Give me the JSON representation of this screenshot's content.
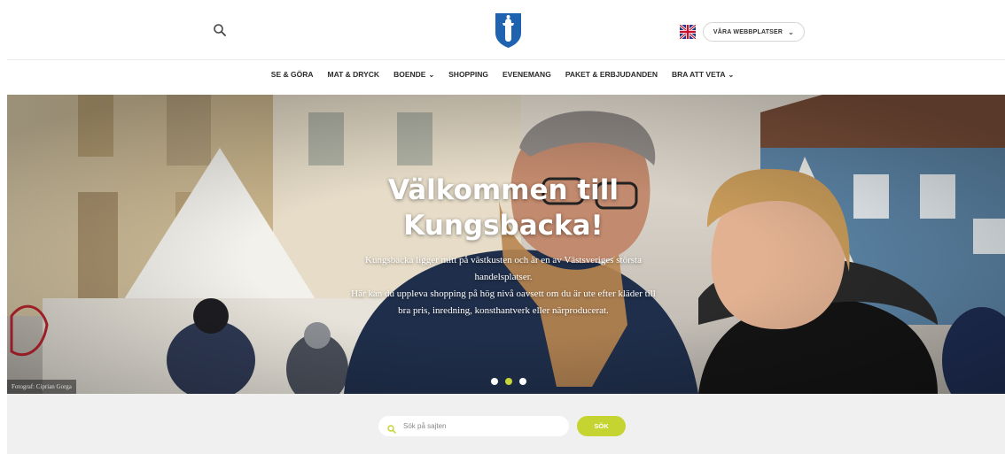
{
  "header": {
    "sites_button_label": "VÅRA WEBBPLATSER",
    "language_flag": "uk-flag-icon",
    "search_icon": "search-icon",
    "logo": "kungsbacka-crest-logo"
  },
  "nav": {
    "items": [
      {
        "label": "SE & GÖRA",
        "has_dropdown": false
      },
      {
        "label": "MAT & DRYCK",
        "has_dropdown": false
      },
      {
        "label": "BOENDE",
        "has_dropdown": true
      },
      {
        "label": "SHOPPING",
        "has_dropdown": false
      },
      {
        "label": "EVENEMANG",
        "has_dropdown": false
      },
      {
        "label": "PAKET & ERBJUDANDEN",
        "has_dropdown": false
      },
      {
        "label": "BRA ATT VETA",
        "has_dropdown": true
      }
    ]
  },
  "hero": {
    "title_line1": "Välkommen till",
    "title_line2": "Kungsbacka!",
    "text_line1": "Kungsbacka ligger mitt på västkusten och är en av Västsveriges största",
    "text_line2": "handelsplatser.",
    "text_line3": "Här kan du uppleva shopping på hög nivå oavsett om du är ute efter kläder till",
    "text_line4": "bra pris, inredning, konsthantverk eller närproducerat.",
    "photo_credit": "Fotograf: Ciprian Gorga",
    "slides_total": 3,
    "active_slide": 2
  },
  "search": {
    "placeholder": "Sök på sajten",
    "button_label": "SÖK"
  },
  "colors": {
    "accent": "#c5d431",
    "logo_blue": "#1f63b0",
    "search_band": "#f0f0f0"
  }
}
